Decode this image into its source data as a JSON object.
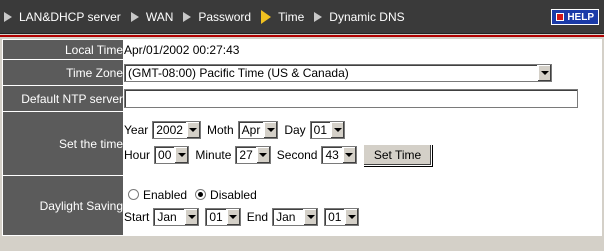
{
  "nav": {
    "items": [
      {
        "label": "LAN&DHCP server",
        "active": false
      },
      {
        "label": "WAN",
        "active": false
      },
      {
        "label": "Password",
        "active": false
      },
      {
        "label": "Time",
        "active": true
      },
      {
        "label": "Dynamic DNS",
        "active": false
      }
    ],
    "help_label": "HELP"
  },
  "form": {
    "local_time": {
      "label": "Local Time",
      "value": "Apr/01/2002 00:27:43"
    },
    "time_zone": {
      "label": "Time Zone",
      "value": "(GMT-08:00) Pacific Time (US & Canada)"
    },
    "ntp": {
      "label": "Default NTP server",
      "value": ""
    },
    "set_time": {
      "label": "Set the time",
      "year_label": "Year",
      "year": "2002",
      "month_label": "Moth",
      "month": "Apr",
      "day_label": "Day",
      "day": "01",
      "hour_label": "Hour",
      "hour": "00",
      "minute_label": "Minute",
      "minute": "27",
      "second_label": "Second",
      "second": "43",
      "button_label": "Set Time"
    },
    "daylight": {
      "label": "Daylight Saving",
      "enabled_label": "Enabled",
      "disabled_label": "Disabled",
      "selected": "Disabled",
      "start_label": "Start",
      "start_month": "Jan",
      "start_day": "01",
      "end_label": "End",
      "end_month": "Jan",
      "end_day": "01"
    }
  },
  "colors": {
    "topbar": "#3a3a3a",
    "label_bg": "#5b5b5b",
    "accent": "#b00000",
    "active_arrow": "#f0c020",
    "help_bg": "#1a3aa8"
  }
}
